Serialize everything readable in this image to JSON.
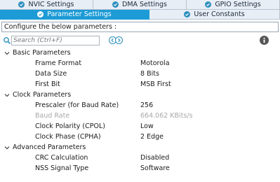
{
  "tabs_top": [
    {
      "label": "NVIC Settings",
      "active": false
    },
    {
      "label": "DMA Settings",
      "active": false
    },
    {
      "label": "GPIO Settings",
      "active": false
    }
  ],
  "tabs_bottom": [
    {
      "label": "Parameter Settings",
      "active": true
    },
    {
      "label": "User Constants",
      "active": false
    }
  ],
  "config_prompt": "Configure the below parameters :",
  "search": {
    "placeholder": "Search (Ctrl+F)",
    "value": ""
  },
  "groups": [
    {
      "label": "Basic Parameters",
      "params": [
        {
          "name": "Frame Format",
          "value": "Motorola",
          "enabled": true
        },
        {
          "name": "Data Size",
          "value": "8 Bits",
          "enabled": true
        },
        {
          "name": "First Bit",
          "value": "MSB First",
          "enabled": true
        }
      ]
    },
    {
      "label": "Clock Parameters",
      "params": [
        {
          "name": "Prescaler (for Baud Rate)",
          "value": "256",
          "enabled": true
        },
        {
          "name": "Baud Rate",
          "value": "664.062 KBits/s",
          "enabled": false
        },
        {
          "name": "Clock Polarity (CPOL)",
          "value": "Low",
          "enabled": true
        },
        {
          "name": "Clock Phase (CPHA)",
          "value": "2 Edge",
          "enabled": true
        }
      ]
    },
    {
      "label": "Advanced Parameters",
      "params": [
        {
          "name": "CRC Calculation",
          "value": "Disabled",
          "enabled": true
        },
        {
          "name": "NSS Signal Type",
          "value": "Software",
          "enabled": true
        }
      ]
    }
  ],
  "colors": {
    "active_tab": "#1d9bd6",
    "tab_bg": "#e8eef5",
    "disabled_text": "#a8a8a8",
    "icon_blue": "#2d8fbf"
  }
}
